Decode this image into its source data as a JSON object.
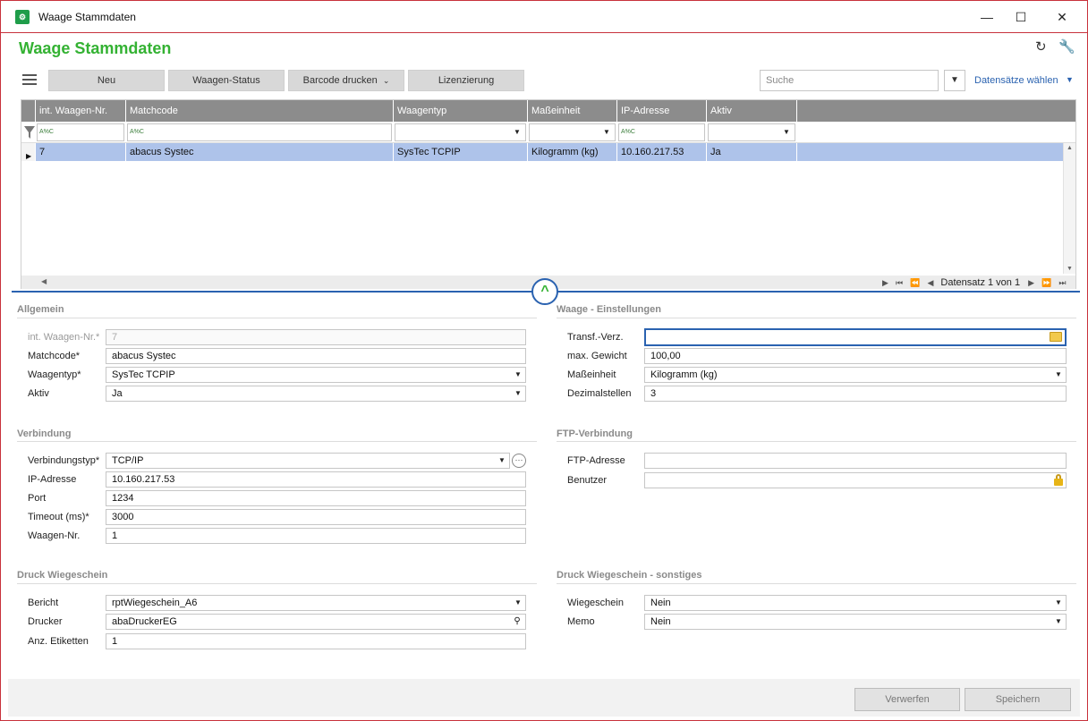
{
  "window": {
    "title": "Waage Stammdaten",
    "minimize_icon": "minimize-icon",
    "maximize_icon": "maximize-icon",
    "close_icon": "close-icon"
  },
  "header": {
    "title": "Waage Stammdaten",
    "accent_color": "#34b233",
    "refresh_icon": "refresh-icon",
    "settings_icon": "wrench-icon"
  },
  "toolbar": {
    "menu_icon": "hamburger-icon",
    "buttons": [
      "Neu",
      "Waagen-Status",
      "Barcode drucken",
      "Lizenzierung"
    ],
    "search_placeholder": "Suche",
    "filter_icon": "dropdown-filter-icon",
    "records_label": "Datensätze wählen"
  },
  "grid": {
    "columns": [
      "int. Waagen-Nr.",
      "Matchcode",
      "Waagentyp",
      "Maßeinheit",
      "IP-Adresse",
      "Aktiv"
    ],
    "filter_tag": "A%C",
    "rows": [
      [
        "7",
        "abacus Systec",
        "SysTec TCPIP",
        "Kilogramm (kg)",
        "10.160.217.53",
        "Ja"
      ]
    ],
    "selected_row_color": "#aec3ea",
    "pager_text": "Datensatz 1 von 1"
  },
  "form": {
    "allgemein": {
      "title": "Allgemein",
      "fields": [
        {
          "label": "int. Waagen-Nr.*",
          "value": "7"
        },
        {
          "label": "Matchcode*",
          "value": "abacus Systec"
        },
        {
          "label": "Waagentyp*",
          "value": "SysTec TCPIP"
        },
        {
          "label": "Aktiv",
          "value": "Ja"
        }
      ]
    },
    "waage": {
      "title": "Waage - Einstellungen",
      "fields": [
        {
          "label": "Transf.-Verz.",
          "value": ""
        },
        {
          "label": "max. Gewicht",
          "value": "100,00"
        },
        {
          "label": "Maßeinheit",
          "value": "Kilogramm (kg)"
        },
        {
          "label": "Dezimalstellen",
          "value": "3"
        }
      ]
    },
    "verbindung": {
      "title": "Verbindung",
      "fields": [
        {
          "label": "Verbindungstyp*",
          "value": "TCP/IP"
        },
        {
          "label": "IP-Adresse",
          "value": "10.160.217.53"
        },
        {
          "label": "Port",
          "value": "1234"
        },
        {
          "label": "Timeout (ms)*",
          "value": "3000"
        },
        {
          "label": "Waagen-Nr.",
          "value": "1"
        }
      ]
    },
    "ftp": {
      "title": "FTP-Verbindung",
      "fields": [
        {
          "label": "FTP-Adresse",
          "value": ""
        },
        {
          "label": "Benutzer",
          "value": ""
        }
      ]
    },
    "druck": {
      "title": "Druck Wiegeschein",
      "fields": [
        {
          "label": "Bericht",
          "value": "rptWiegeschein_A6"
        },
        {
          "label": "Drucker",
          "value": "abaDruckerEG"
        },
        {
          "label": "Anz. Etiketten",
          "value": "1"
        }
      ]
    },
    "druck_sonstiges": {
      "title": "Druck Wiegeschein - sonstiges",
      "fields": [
        {
          "label": "Wiegeschein",
          "value": "Nein"
        },
        {
          "label": "Memo",
          "value": "Nein"
        }
      ]
    }
  },
  "footer": {
    "discard_label": "Verwerfen",
    "save_label": "Speichern"
  }
}
